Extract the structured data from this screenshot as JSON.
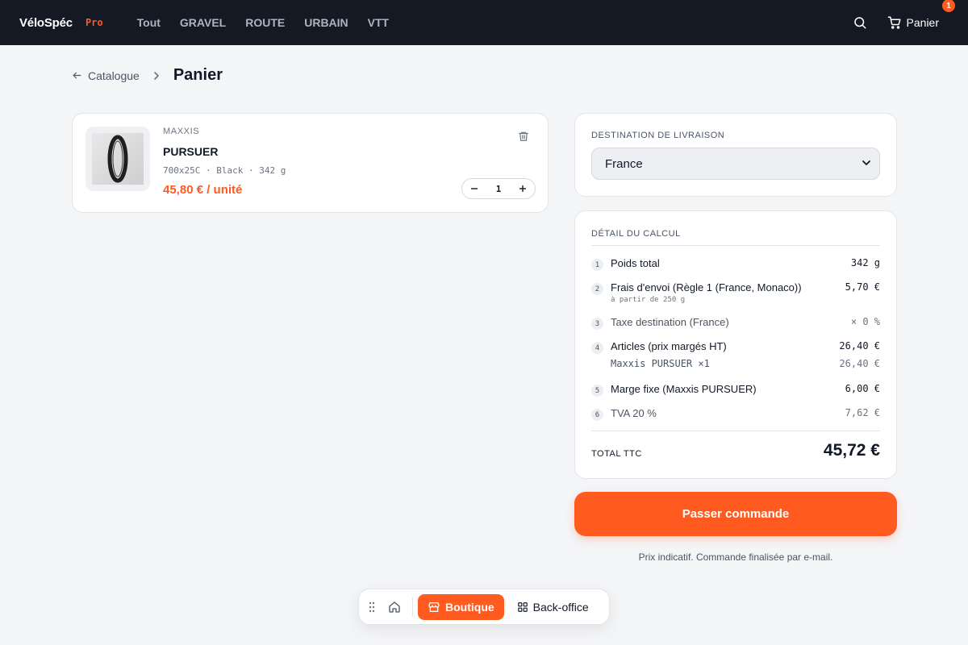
{
  "header": {
    "brand": "VéloSpéc",
    "brand_badge": "Pro",
    "nav": [
      "Tout",
      "GRAVEL",
      "ROUTE",
      "URBAIN",
      "VTT"
    ],
    "cart_label": "Panier",
    "cart_count": "1"
  },
  "breadcrumb": {
    "back_label": "Catalogue",
    "title": "Panier"
  },
  "cart_item": {
    "brand": "MAXXIS",
    "name": "PURSUER",
    "specs": "700x25C · Black · 342 g",
    "price": "45,80 € / unité",
    "quantity": "1"
  },
  "destination": {
    "label": "DESTINATION DE LIVRAISON",
    "selected": "France"
  },
  "calc": {
    "label": "DÉTAIL DU CALCUL",
    "rows": [
      {
        "num": "1",
        "label": "Poids total",
        "value": "342 g"
      },
      {
        "num": "2",
        "label": "Frais d'envoi (Règle 1 (France, Monaco))",
        "value": "5,70 €",
        "sub": "à partir de 250 g"
      },
      {
        "num": "3",
        "label": "Taxe destination (France)",
        "value": "× 0 %"
      },
      {
        "num": "4",
        "label": "Articles (prix margés HT)",
        "value": "26,40 €"
      },
      {
        "num": "5",
        "label": "Marge fixe (Maxxis PURSUER)",
        "value": "6,00 €"
      },
      {
        "num": "6",
        "label": "TVA 20 %",
        "value": "7,62 €"
      }
    ],
    "article_line": {
      "label": "Maxxis PURSUER ×1",
      "value": "26,40 €"
    },
    "total_label": "TOTAL TTC",
    "total_value": "45,72 €"
  },
  "cta": {
    "label": "Passer commande",
    "note": "Prix indicatif. Commande finalisée par e-mail."
  },
  "dock": {
    "shop_label": "Boutique",
    "backoffice_label": "Back-office"
  },
  "colors": {
    "accent": "#ff5a1f",
    "topbar": "#141923",
    "background": "#f4f5f7"
  }
}
